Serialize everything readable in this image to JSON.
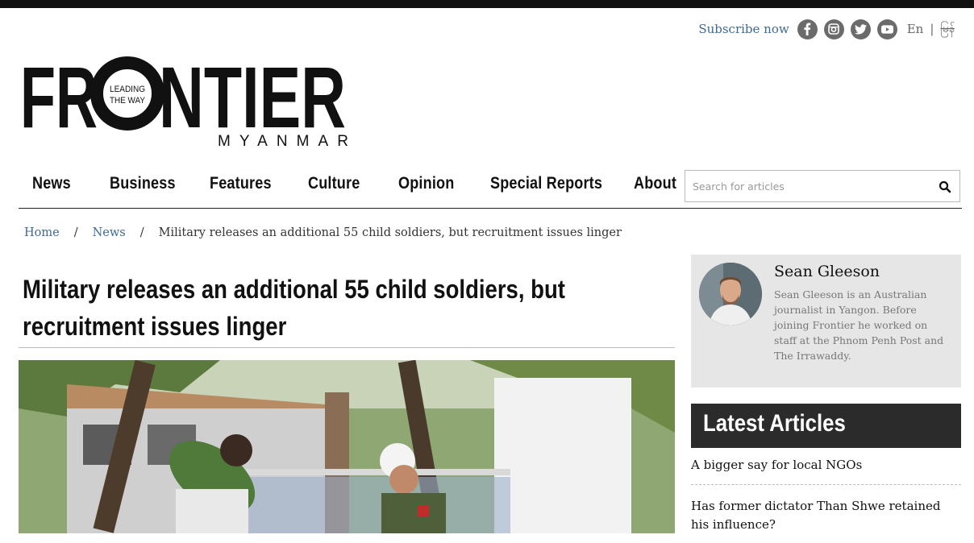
{
  "header": {
    "subscribe_label": "Subscribe now",
    "social": [
      "facebook-icon",
      "instagram-icon",
      "twitter-icon",
      "youtube-icon"
    ],
    "lang_en": "En",
    "lang_sep": "|",
    "lang_mm": "မြန်"
  },
  "logo": {
    "wordmark_left": "FR",
    "wordmark_right": "NTIER",
    "tagline_1": "LEADING",
    "tagline_2": "THE WAY",
    "subtitle": "MYANMAR"
  },
  "nav": {
    "items": [
      "News",
      "Business",
      "Features",
      "Culture",
      "Opinion",
      "Special Reports",
      "About"
    ],
    "search_placeholder": "Search for articles"
  },
  "breadcrumb": {
    "home": "Home",
    "sep": "/",
    "section": "News",
    "current": "Military releases an additional 55 child soldiers, but recruitment issues linger"
  },
  "article": {
    "title": "Military releases an additional 55 child soldiers, but recruitment issues linger"
  },
  "author": {
    "name": "Sean Gleeson",
    "bio": "Sean Gleeson is an Australian journalist in Yangon. Before joining Frontier he worked on staff at the Phnom Penh Post and The Irrawaddy."
  },
  "latest": {
    "heading": "Latest Articles",
    "items": [
      "A bigger say for local NGOs",
      "Has former dictator Than Shwe retained his influence?"
    ]
  },
  "colors": {
    "link": "#3d6a96",
    "social_bg": "#6b6b6b",
    "sidebar_bg": "#e6e6e6",
    "latest_bg": "#2b2b2b"
  }
}
